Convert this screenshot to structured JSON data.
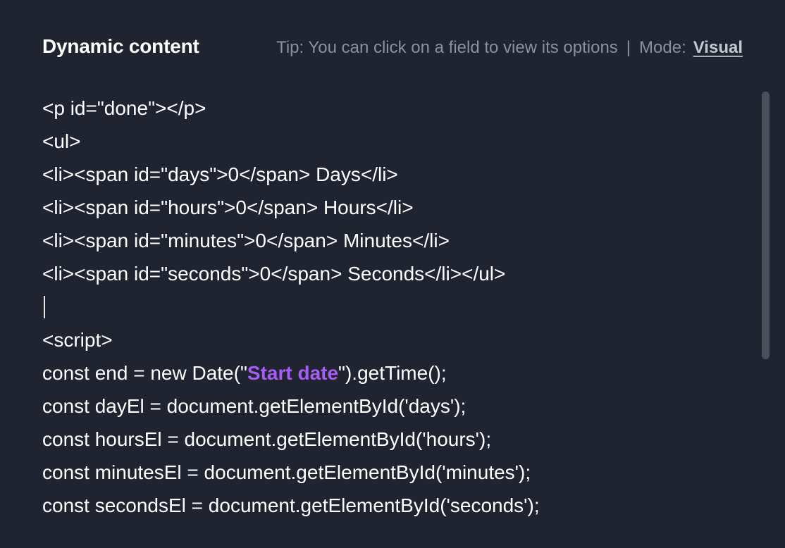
{
  "header": {
    "title": "Dynamic content",
    "tip": "Tip: You can click on a field to view its options",
    "separator": "|",
    "mode_label": "Mode:",
    "mode_value": "Visual"
  },
  "editor": {
    "lines": [
      {
        "type": "plain",
        "text": "<p id=\"done\"></p>"
      },
      {
        "type": "plain",
        "text": "<ul>"
      },
      {
        "type": "plain",
        "text": "<li><span id=\"days\">0</span> Days</li>"
      },
      {
        "type": "plain",
        "text": "<li><span id=\"hours\">0</span> Hours</li>"
      },
      {
        "type": "plain",
        "text": "<li><span id=\"minutes\">0</span> Minutes</li>"
      },
      {
        "type": "plain",
        "text": "<li><span id=\"seconds\">0</span> Seconds</li></ul>"
      },
      {
        "type": "cursor"
      },
      {
        "type": "plain",
        "text": "<script>"
      },
      {
        "type": "field",
        "pre": "const end = new Date(\"",
        "field": "Start date",
        "post": "\").getTime();"
      },
      {
        "type": "plain",
        "text": "const dayEl = document.getElementById('days');"
      },
      {
        "type": "plain",
        "text": "const hoursEl = document.getElementById('hours');"
      },
      {
        "type": "plain",
        "text": "const minutesEl = document.getElementById('minutes');"
      },
      {
        "type": "plain",
        "text": "const secondsEl = document.getElementById('seconds');"
      }
    ]
  }
}
